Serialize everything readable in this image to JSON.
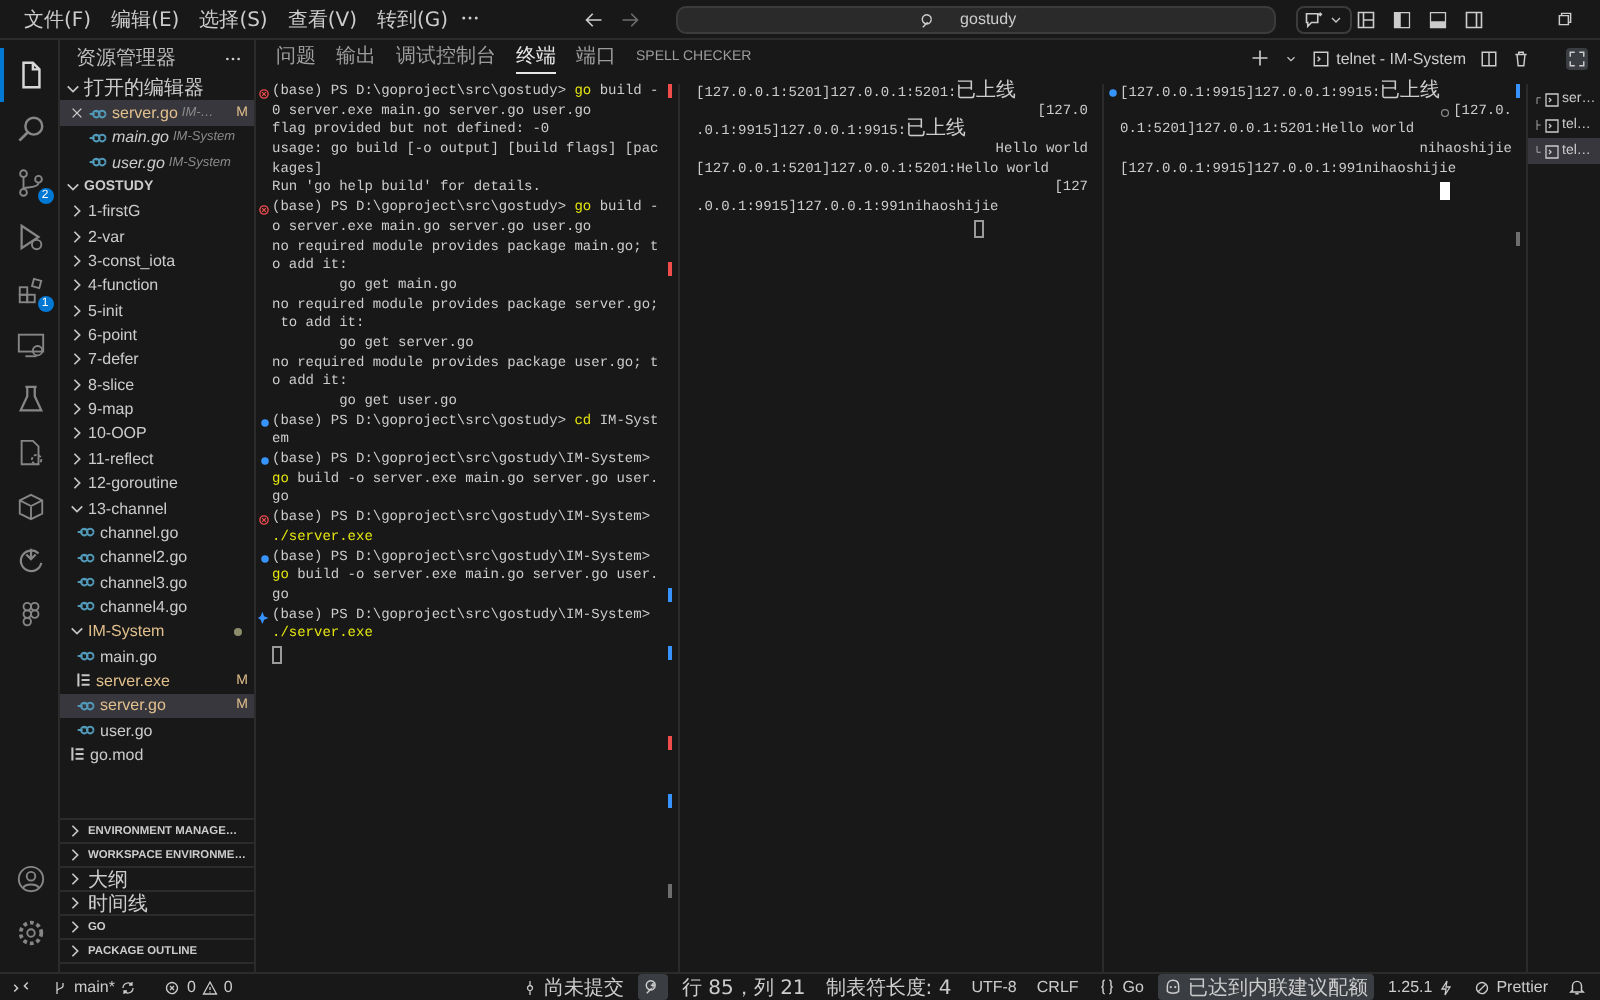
{
  "title_bar": {
    "menus": [
      "文件(F)",
      "编辑(E)",
      "选择(S)",
      "查看(V)",
      "转到(G)"
    ],
    "search": {
      "value": "gostudy"
    }
  },
  "activity_bar": {
    "items": [
      {
        "kind": "files",
        "selected": true
      },
      {
        "kind": "search",
        "selected": false
      },
      {
        "kind": "source-control",
        "selected": false,
        "badge": "2"
      },
      {
        "kind": "run",
        "selected": false
      },
      {
        "kind": "extensions",
        "selected": false,
        "badge": "1"
      },
      {
        "kind": "remote",
        "selected": false
      },
      {
        "kind": "testing",
        "selected": false
      },
      {
        "kind": "document",
        "selected": false
      },
      {
        "kind": "package",
        "selected": false
      },
      {
        "kind": "arc",
        "selected": false
      },
      {
        "kind": "shapes",
        "selected": false
      }
    ],
    "bottom": [
      {
        "kind": "account"
      },
      {
        "kind": "settings"
      }
    ]
  },
  "sidebar": {
    "title": "资源管理器",
    "open_editors": {
      "title": "打开的编辑器",
      "expanded": true,
      "items": [
        {
          "name": "server.go",
          "folder": "IM-…",
          "badge": "M",
          "selected": true,
          "preview": false
        },
        {
          "name": "main.go",
          "folder": "IM-System",
          "selected": false,
          "preview": true
        },
        {
          "name": "user.go",
          "folder": "IM-System",
          "selected": false,
          "preview": true
        }
      ]
    },
    "explorer": {
      "title": "GOSTUDY",
      "expanded": true,
      "children": [
        {
          "name": "1-firstG",
          "kind": "folder",
          "expanded": false,
          "selected": false
        },
        {
          "name": "2-var",
          "kind": "folder",
          "expanded": false,
          "selected": false
        },
        {
          "name": "3-const_iota",
          "kind": "folder",
          "expanded": false,
          "selected": false
        },
        {
          "name": "4-function",
          "kind": "folder",
          "expanded": false,
          "selected": false
        },
        {
          "name": "5-init",
          "kind": "folder",
          "expanded": false,
          "selected": false
        },
        {
          "name": "6-point",
          "kind": "folder",
          "expanded": false,
          "selected": false
        },
        {
          "name": "7-defer",
          "kind": "folder",
          "expanded": false,
          "selected": false
        },
        {
          "name": "8-slice",
          "kind": "folder",
          "expanded": false,
          "selected": false
        },
        {
          "name": "9-map",
          "kind": "folder",
          "expanded": false,
          "selected": false
        },
        {
          "name": "10-OOP",
          "kind": "folder",
          "expanded": false,
          "selected": false
        },
        {
          "name": "11-reflect",
          "kind": "folder",
          "expanded": false,
          "selected": false
        },
        {
          "name": "12-goroutine",
          "kind": "folder",
          "expanded": false,
          "selected": false
        },
        {
          "name": "13-channel",
          "kind": "folder",
          "expanded": true,
          "selected": false,
          "children": [
            {
              "name": "channel.go",
              "kind": "go",
              "selected": false
            },
            {
              "name": "channel2.go",
              "kind": "go",
              "selected": false
            },
            {
              "name": "channel3.go",
              "kind": "go",
              "selected": false
            },
            {
              "name": "channel4.go",
              "kind": "go",
              "selected": false
            }
          ]
        },
        {
          "name": "IM-System",
          "kind": "folder",
          "expanded": true,
          "selected": false,
          "modified": true,
          "children": [
            {
              "name": "main.go",
              "kind": "go",
              "selected": false
            },
            {
              "name": "server.exe",
              "kind": "binary",
              "selected": false,
              "modified": true,
              "badge": "M"
            },
            {
              "name": "server.go",
              "kind": "go",
              "selected": true,
              "modified": true,
              "badge": "M"
            },
            {
              "name": "user.go",
              "kind": "go",
              "selected": false
            }
          ]
        },
        {
          "name": "go.mod",
          "kind": "binary",
          "selected": false
        }
      ]
    },
    "sections": [
      {
        "title": "ENVIRONMENT MANAGE…",
        "expanded": false
      },
      {
        "title": "WORKSPACE ENVIRONME…",
        "expanded": false
      },
      {
        "title": "大纲",
        "expanded": false
      },
      {
        "title": "时间线",
        "expanded": false
      },
      {
        "title": "GO",
        "expanded": false
      },
      {
        "title": "PACKAGE OUTLINE",
        "expanded": false
      }
    ]
  },
  "panel": {
    "tabs": [
      {
        "label": "问题",
        "selected": false
      },
      {
        "label": "输出",
        "selected": false
      },
      {
        "label": "调试控制台",
        "selected": false
      },
      {
        "label": "终端",
        "selected": true
      },
      {
        "label": "端口",
        "selected": false
      },
      {
        "label": "SPELL CHECKER",
        "selected": false
      }
    ],
    "terminal_title": "telnet - IM-System",
    "panes": [
      {
        "focused": false,
        "lines": [
          {
            "kind": "error",
            "prompt": "(base) PS D:\\goproject\\src\\gostudy> ",
            "command": "go",
            "text": " build -"
          },
          {
            "text": "0 server.exe main.go server.go user.go"
          },
          {
            "text": "flag provided but not defined: -0"
          },
          {
            "text": "usage: go build [-o output] [build flags] [pac"
          },
          {
            "text": "kages]"
          },
          {
            "text": "Run 'go help build' for details."
          },
          {
            "kind": "error",
            "prompt": "(base) PS D:\\goproject\\src\\gostudy> ",
            "command": "go",
            "text": " build -"
          },
          {
            "text": "o server.exe main.go server.go user.go"
          },
          {
            "text": "no required module provides package main.go; t"
          },
          {
            "text": "o add it:"
          },
          {
            "text": "        go get main.go"
          },
          {
            "text": "no required module provides package server.go;"
          },
          {
            "text": " to add it:"
          },
          {
            "text": "        go get server.go"
          },
          {
            "text": "no required module provides package user.go; t"
          },
          {
            "text": "o add it:"
          },
          {
            "text": "        go get user.go"
          },
          {
            "kind": "success",
            "prompt": "(base) PS D:\\goproject\\src\\gostudy> ",
            "command": "cd",
            "text": " IM-Syst"
          },
          {
            "text": "em"
          },
          {
            "kind": "success",
            "prompt": "(base) PS D:\\goproject\\src\\gostudy\\IM-System>"
          },
          {
            "command": "go",
            "text": " build -o server.exe main.go server.go user."
          },
          {
            "text": "go"
          },
          {
            "kind": "error",
            "prompt": "(base) PS D:\\goproject\\src\\gostudy\\IM-System>"
          },
          {
            "command": "./server.exe"
          },
          {
            "kind": "success",
            "prompt": "(base) PS D:\\goproject\\src\\gostudy\\IM-System>"
          },
          {
            "command": "go",
            "text": " build -o server.exe main.go server.go user."
          },
          {
            "text": "go"
          },
          {
            "kind": "running",
            "prompt": "(base) PS D:\\goproject\\src\\gostudy\\IM-System>"
          },
          {
            "command": "./server.exe"
          }
        ]
      },
      {
        "focused": false,
        "lines": [
          {
            "text": "[127.0.0.1:5201]127.0.0.1:5201:已上线",
            "right_aligned": false
          },
          {
            "text": "[127.0",
            "right_aligned": true
          },
          {
            "text": ".0.1:9915]127.0.0.1:9915:已上线",
            "right_aligned": false
          },
          {
            "text": "Hello world",
            "right_aligned": true
          },
          {
            "text": "[127.0.0.1:5201]127.0.0.1:5201:Hello world",
            "right_aligned": false
          },
          {
            "text": "[127",
            "right_aligned": true
          },
          {
            "text": ".0.0.1:9915]127.0.0.1:991nihaoshijie",
            "right_aligned": false
          }
        ]
      },
      {
        "focused": true,
        "lines": [
          {
            "kind": "success",
            "text": "[127.0.0.1:9915]127.0.0.1:9915:已上线",
            "right_aligned": false
          },
          {
            "kind": "pending",
            "text": "[127.0.",
            "right_aligned": true
          },
          {
            "text": "0.1:5201]127.0.0.1:5201:Hello world",
            "right_aligned": false
          },
          {
            "text": "nihaoshijie",
            "right_aligned": true
          },
          {
            "text": "[127.0.0.1:9915]127.0.0.1:991nihaoshijie",
            "right_aligned": false
          }
        ]
      }
    ],
    "terminals": [
      {
        "name": "ser…",
        "selected": false
      },
      {
        "name": "tel…",
        "selected": false
      },
      {
        "name": "tel…",
        "selected": true
      }
    ]
  },
  "status_bar": {
    "branch": "main*",
    "errors": "0",
    "warnings": "0",
    "items": [
      {
        "kind": "commit",
        "text": "尚未提交",
        "highlighted": false
      },
      {
        "kind": "zoom",
        "highlighted": true
      },
      {
        "kind": "text",
        "text": "行 85，列 21",
        "highlighted": false
      },
      {
        "kind": "text",
        "text": "制表符长度: 4",
        "highlighted": false
      },
      {
        "kind": "text",
        "text": "UTF-8",
        "highlighted": false
      },
      {
        "kind": "text",
        "text": "CRLF",
        "highlighted": false
      },
      {
        "kind": "language",
        "text": "Go",
        "highlighted": false
      },
      {
        "kind": "copilot",
        "text": "已达到内联建议配额",
        "highlighted": true
      },
      {
        "kind": "version",
        "text": "1.25.1",
        "highlighted": false
      },
      {
        "kind": "prettier",
        "text": "Prettier",
        "highlighted": false
      },
      {
        "kind": "bell",
        "highlighted": false
      }
    ]
  }
}
